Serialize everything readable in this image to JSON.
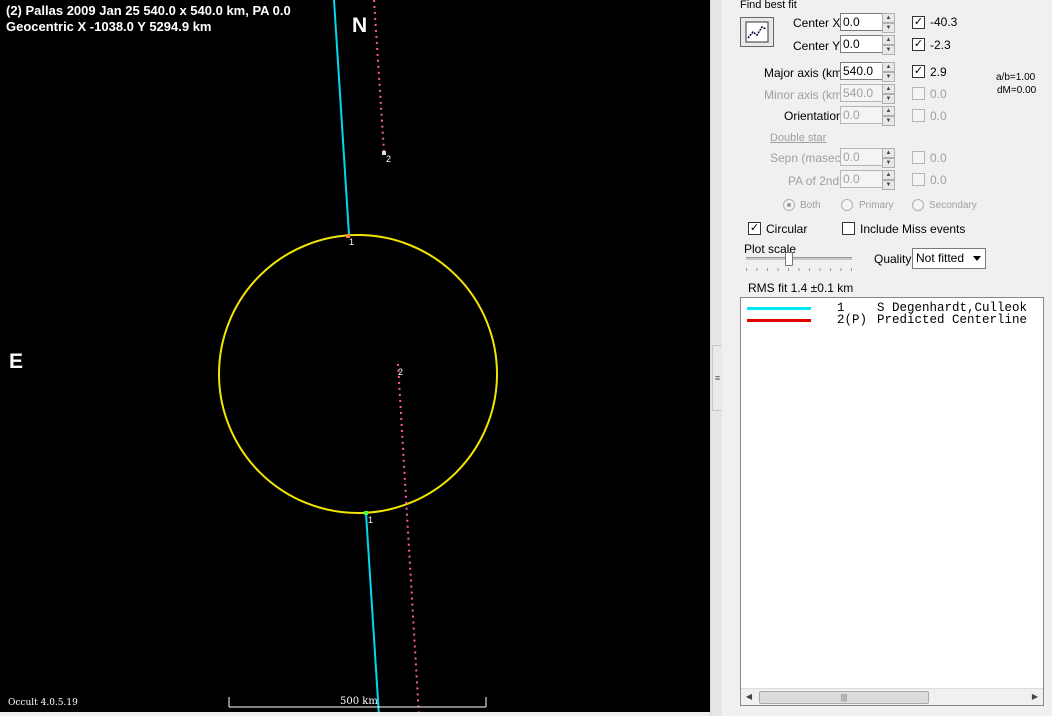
{
  "plot": {
    "title_line1": "(2) Pallas  2009 Jan 25  540.0 x 540.0 km, PA 0.0",
    "title_line2": "Geocentric  X  -1038.0  Y 5294.9 km",
    "north_label": "N",
    "east_label": "E",
    "version": "Occult 4.0.5.19",
    "scale_bar_label": "500 km",
    "chord_labels": [
      "1",
      "1",
      "2",
      "2"
    ],
    "colors": {
      "background": "#000000",
      "ellipse": "#f2e600",
      "observed_chord": "#00d8f0",
      "predicted_chord": "#ff5aa0"
    }
  },
  "panel": {
    "group_title": "Find best fit",
    "fit_button_icon": "fit-chart-icon",
    "center_x": {
      "label": "Center X",
      "value": "0.0",
      "checked": true,
      "result": "-40.3"
    },
    "center_y": {
      "label": "Center Y",
      "value": "0.0",
      "checked": true,
      "result": "-2.3"
    },
    "major_axis": {
      "label": "Major axis (km)",
      "value": "540.0",
      "checked": true,
      "result": "2.9"
    },
    "minor_axis": {
      "label": "Minor axis (km)",
      "value": "540.0",
      "checked": false,
      "result": "0.0"
    },
    "orientation": {
      "label": "Orientation",
      "value": "0.0",
      "checked": false,
      "result": "0.0"
    },
    "ab_ratio": "a/b=1.00",
    "dm": "dM=0.00",
    "double_star_label": "Double star",
    "sepn": {
      "label": "Sepn (masec)",
      "value": "0.0",
      "checked": false,
      "result": "0.0"
    },
    "pa_2nd": {
      "label": "PA of 2nd",
      "value": "0.0",
      "checked": false,
      "result": "0.0"
    },
    "radio_options": [
      "Both",
      "Primary",
      "Secondary"
    ],
    "radio_selected": "Both",
    "circular_label": "Circular",
    "include_miss_label": "Include Miss events",
    "plot_scale_label": "Plot scale",
    "plot_scale_value": 0.4,
    "quality_label": "Quality",
    "quality_value": "Not fitted",
    "rms_text": "RMS fit  1.4 ±0.1 km",
    "chord_list": [
      {
        "num": "1",
        "name": "S Degenhardt,Culleok",
        "color": "#00e8f8"
      },
      {
        "num": "2(P)",
        "name": "Predicted Centerline",
        "color": "#e00000"
      }
    ]
  }
}
